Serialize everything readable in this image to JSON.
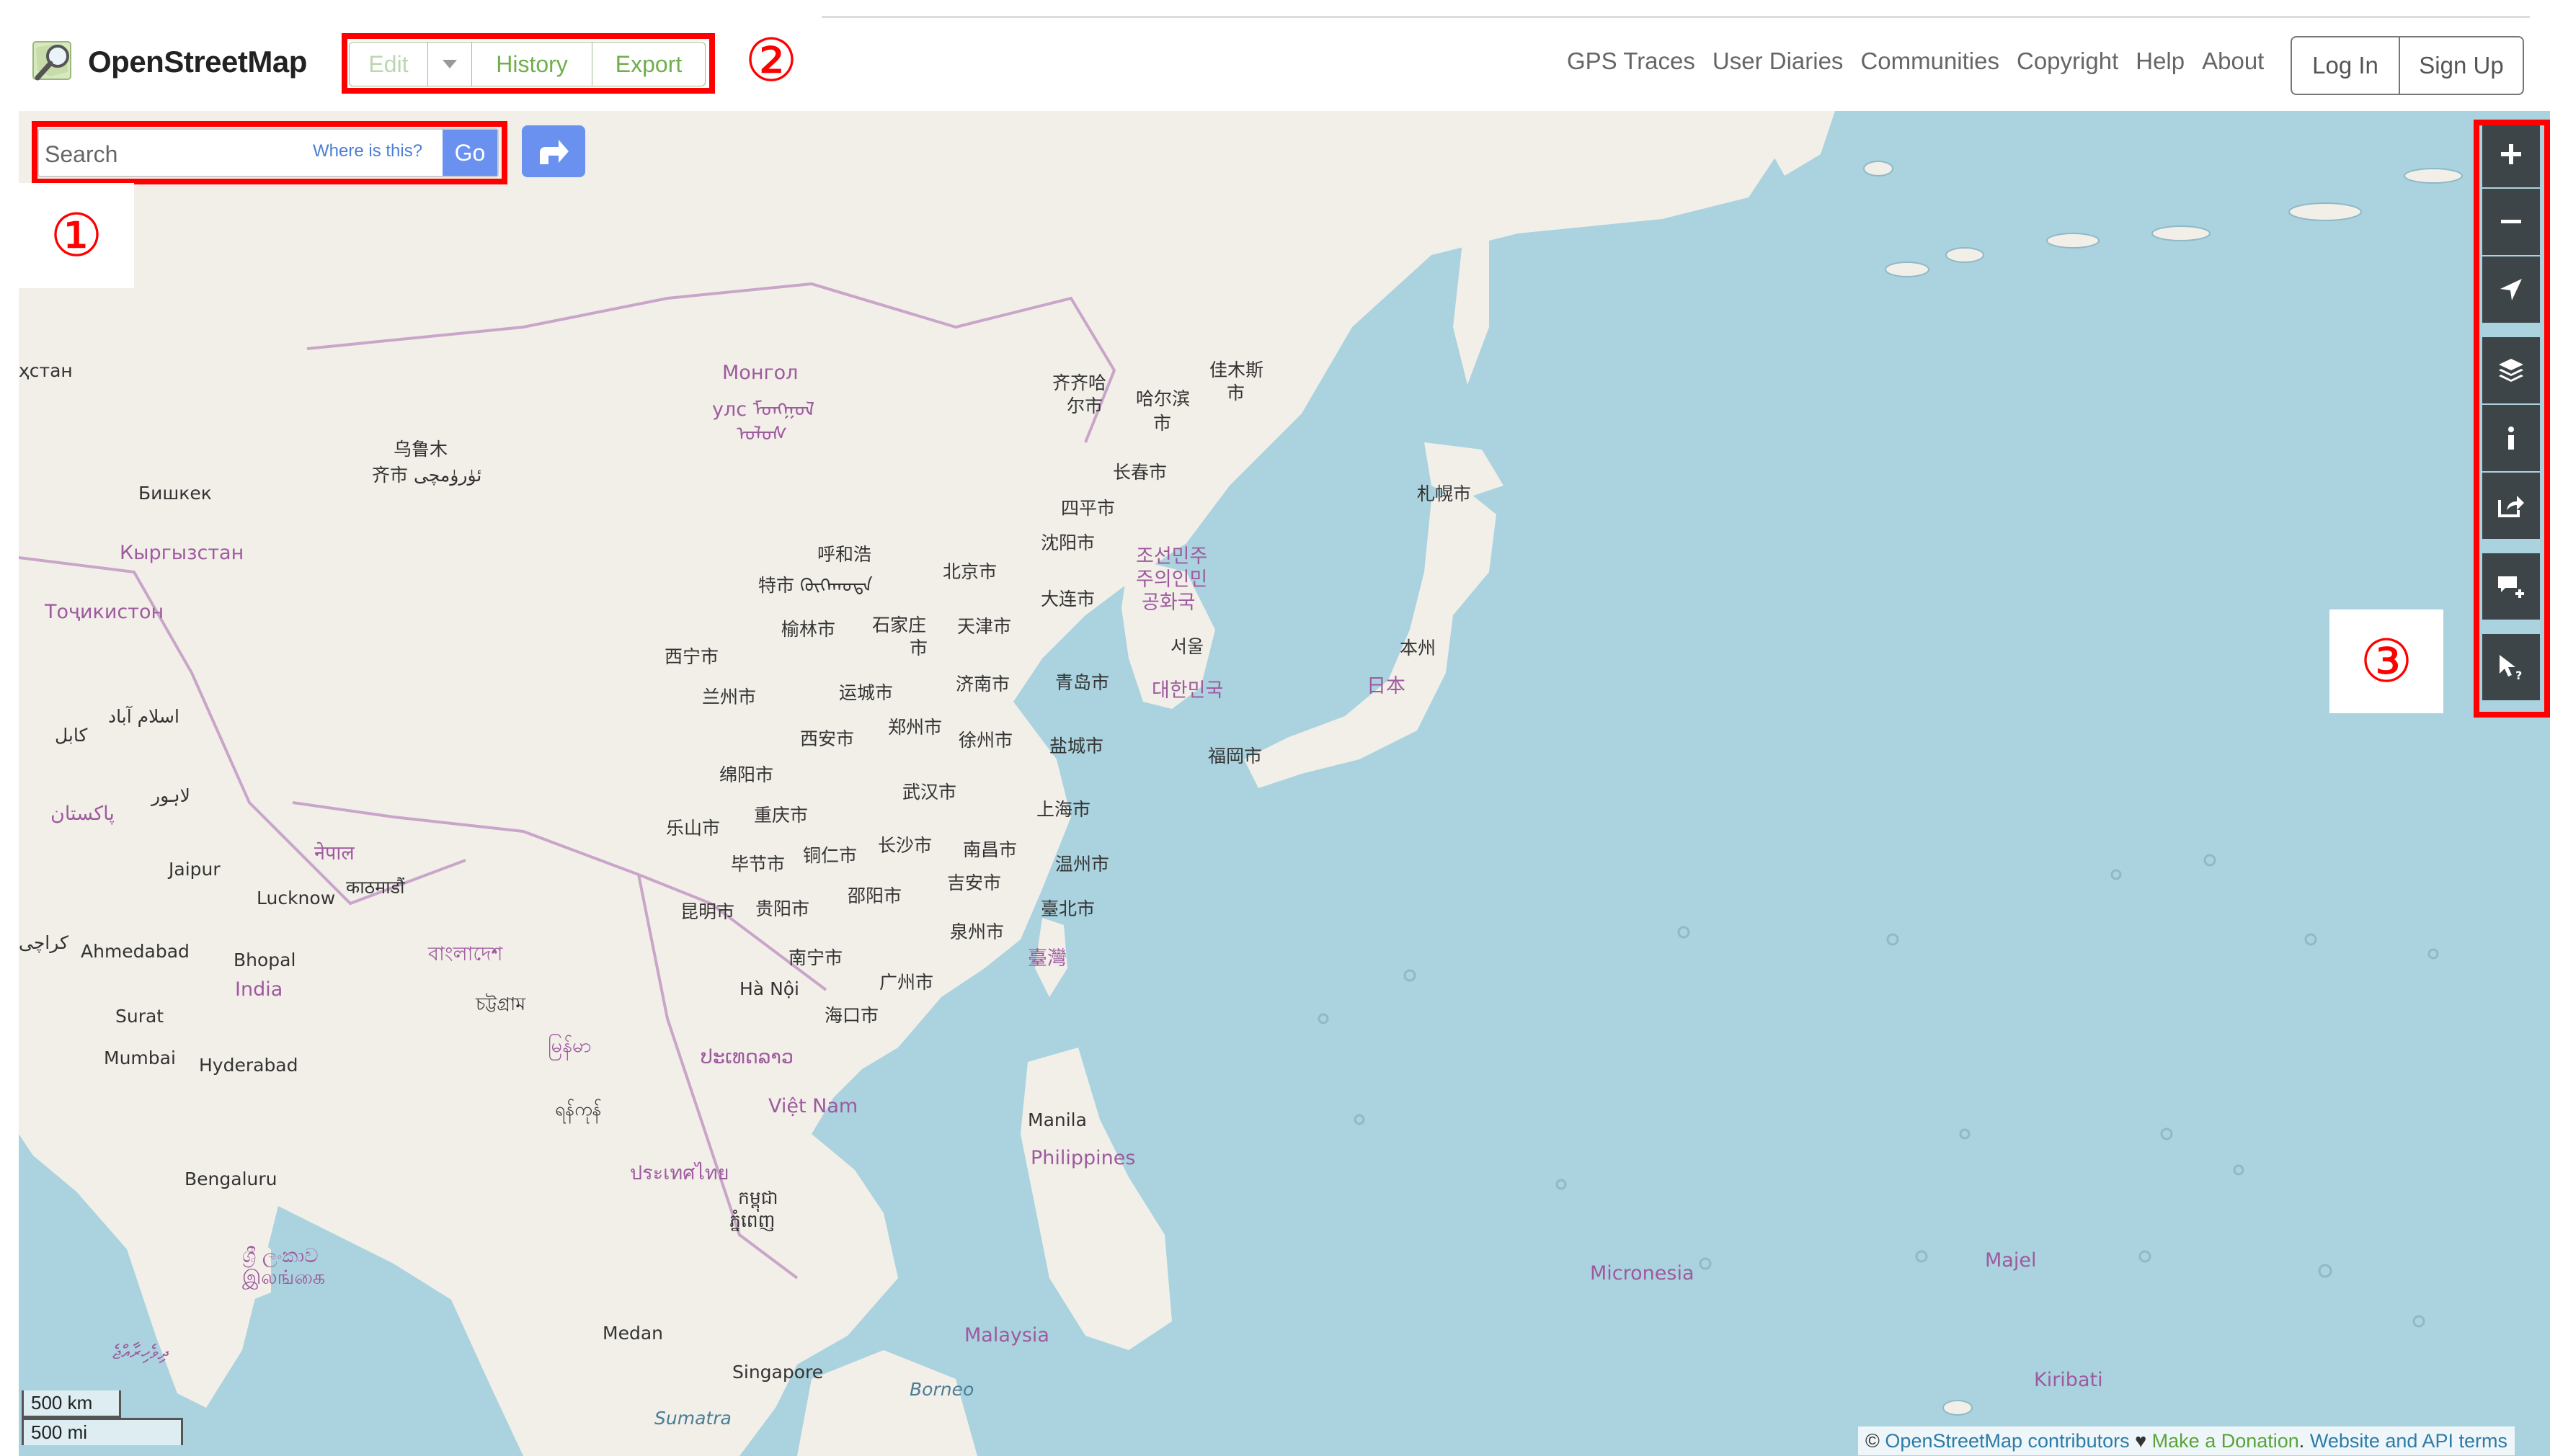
{
  "header": {
    "brand": "OpenStreetMap",
    "edit_label": "Edit",
    "history_label": "History",
    "export_label": "Export",
    "nav": [
      "GPS Traces",
      "User Diaries",
      "Communities",
      "Copyright",
      "Help",
      "About"
    ],
    "login_label": "Log In",
    "signup_label": "Sign Up"
  },
  "search": {
    "placeholder": "Search",
    "where_is_this": "Where is this?",
    "go_label": "Go"
  },
  "annotations": {
    "one": "①",
    "two": "②",
    "three": "③"
  },
  "map_labels": {
    "kazakhstan": "ҳстан",
    "mongolia": "Монгол",
    "mongolia2": "улс ᠮᠣᠩᠭᠣᠯ",
    "mongolia3": "ᠤᠯᠤᠰ",
    "urumqi": "乌鲁木",
    "urumqi2": "齐市 ئۈرۈمچى",
    "bishkek": "Бишкек",
    "kyrgyzstan": "Кыргызстан",
    "tajikistan": "Тоҷикистон",
    "islamabad": "اسلام آباد",
    "kabul": "کابل",
    "lahore": "لاہور",
    "pakistan": "پاکستان",
    "karachi": "کراچی",
    "qiqihar": "齐齐哈",
    "qiqihar2": "尔市",
    "harbin": "哈尔滨",
    "harbin2": "市",
    "jiamusi": "佳木斯",
    "jiamusi2": "市",
    "changchun": "长春市",
    "siping": "四平市",
    "shenyang": "沈阳市",
    "hohhot": "呼和浩",
    "hohhot2": "特市 ᠬᠥᠬᠡᠬᠣᠲᠠ",
    "beijing": "北京市",
    "nkorea1": "조선민주",
    "nkorea2": "주의인민",
    "nkorea3": "공화국",
    "dalian": "大连市",
    "yulin": "榆林市",
    "shijiazhuang": "石家庄",
    "shijiazhuang2": "市",
    "tianjin": "天津市",
    "seoul": "서울",
    "skorea": "대한민국",
    "sapporo": "札幌市",
    "honshu": "本州",
    "japan": "日本",
    "xining": "西宁市",
    "lanzhou": "兰州市",
    "yuncheng": "运城市",
    "jinan": "济南市",
    "qingdao": "青岛市",
    "zhengzhou": "郑州市",
    "xian": "西安市",
    "xuzhou": "徐州市",
    "yancheng": "盐城市",
    "fukuoka": "福岡市",
    "mianyang": "绵阳市",
    "wuhan": "武汉市",
    "chongqing": "重庆市",
    "shanghai": "上海市",
    "leshan": "乐山市",
    "bijie": "毕节市",
    "tongren": "铜仁市",
    "changsha": "长沙市",
    "nanchang": "南昌市",
    "wenzhou": "温州市",
    "jian": "吉安市",
    "kunming": "昆明市",
    "guiyang": "贵阳市",
    "shaoyang": "邵阳市",
    "taipei": "臺北市",
    "quanzhou": "泉州市",
    "taiwan": "臺灣",
    "nanning": "南宁市",
    "guangzhou": "广州市",
    "hanoi": "Hà Nội",
    "haikou": "海口市",
    "nepal": "नेपाल",
    "kathmandu": "काठमाडौं",
    "jaipur": "Jaipur",
    "lucknow": "Lucknow",
    "ahmedabad": "Ahmedabad",
    "bhopal": "Bhopal",
    "india": "India",
    "bangladesh": "বাংলাদেশ",
    "chittagong": "চট্টগ্রাম",
    "myanmar": "မြန်မာ",
    "laos": "ປະເທດລາວ",
    "vietnam": "Việt Nam",
    "surat": "Surat",
    "mumbai": "Mumbai",
    "hyderabad": "Hyderabad",
    "yangon": "ရန်ကုန်",
    "thailand": "ประเทศไทย",
    "cambodia": "កម្ពុជា",
    "phnompenh": "ភ្នំពេញ",
    "manila": "Manila",
    "philippines": "Philippines",
    "bengaluru": "Bengaluru",
    "srilanka": "ශ්‍රී ලංකාව",
    "srilanka2": "இலங்கை",
    "micronesia": "Micronesia",
    "majel": "Majel",
    "maldives": "ދިވެހިރާއްޖެ",
    "medan": "Medan",
    "malaysia": "Malaysia",
    "singapore": "Singapore",
    "borneo": "Borneo",
    "sumatra": "Sumatra",
    "kiribati": "Kiribati"
  },
  "controls": [
    "zoom-in-icon",
    "zoom-out-icon",
    "locate-icon",
    "layers-icon",
    "info-icon",
    "share-icon",
    "add-note-icon",
    "query-icon"
  ],
  "scale": {
    "km": "500 km",
    "mi": "500 mi"
  },
  "attribution": {
    "prefix": "©",
    "osm_link": "OpenStreetMap contributors",
    "heart": "♥",
    "donate": "Make a Donation",
    "sep": ".",
    "terms": "Website and API terms"
  },
  "colors": {
    "water": "#aad3df",
    "land": "#f2efe9",
    "accent_green": "#6fae4a",
    "button_blue": "#6a91f0",
    "control_dark": "#3e4548",
    "annotation_red": "#ff0000"
  }
}
